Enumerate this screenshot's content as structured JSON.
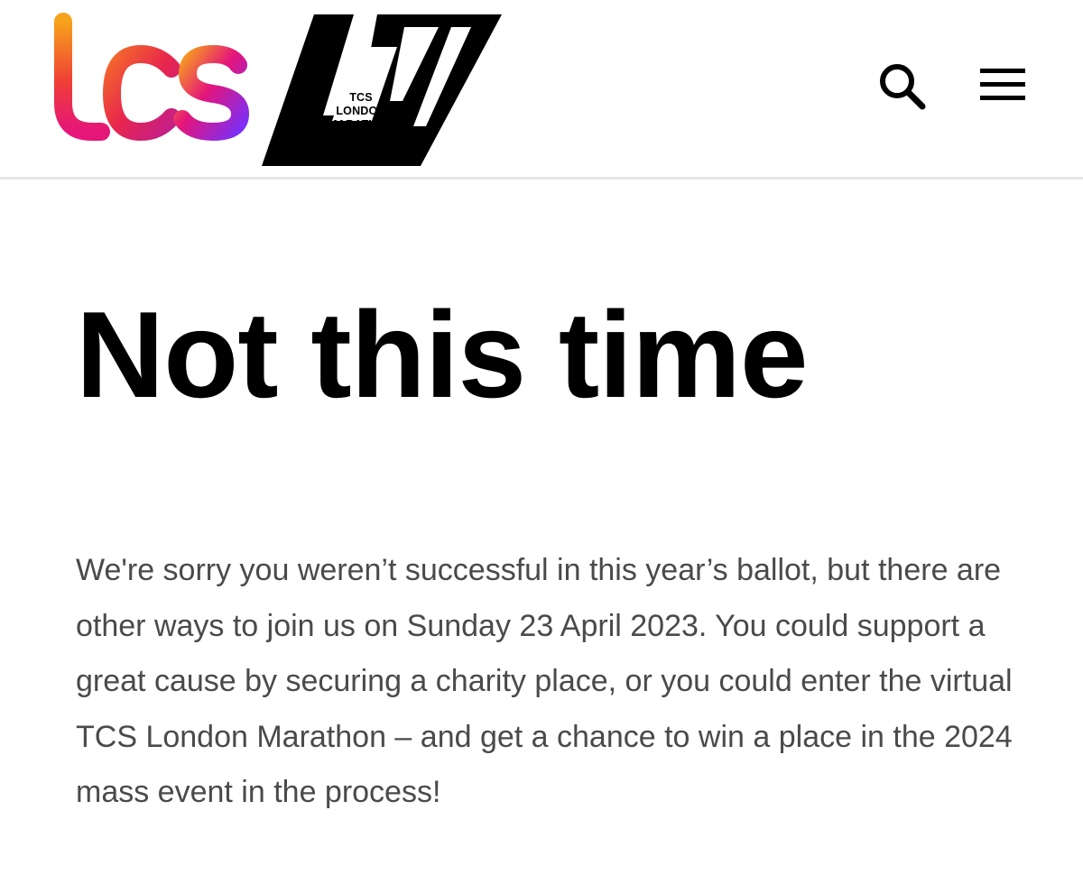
{
  "header": {
    "tcs_logo_text": "tcs",
    "marathon_logo": {
      "line1": "TCS",
      "line2": "LONDON",
      "line3": "MARATHON"
    },
    "search_icon": "search-icon",
    "menu_icon": "hamburger-menu-icon"
  },
  "main": {
    "title": "Not this time",
    "message": "We're sorry you weren’t successful in this year’s ballot, but there are other ways to join us on Sunday 23 April 2023. You could support a great cause by securing a charity place, or you could enter the virtual TCS London Marathon – and get a chance to win a place in the 2024 mass event in the process!"
  },
  "colors": {
    "title": "#000000",
    "body_text": "#4a4a4a",
    "divider": "#e6e6e6",
    "tcs_gradient": [
      "#f7a21b",
      "#ef3e36",
      "#e5157a",
      "#8a2be2"
    ]
  }
}
